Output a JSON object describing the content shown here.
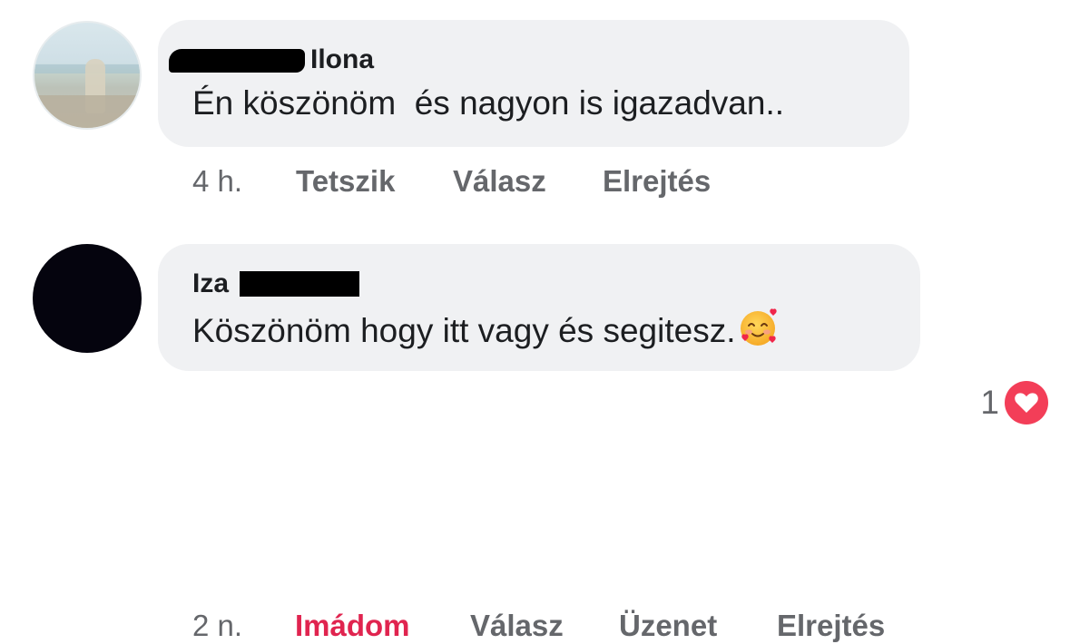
{
  "comments": [
    {
      "author_visible": "Ilona",
      "text": "Én köszönöm  és nagyon is igazadvan..",
      "actions": {
        "time": "4 h.",
        "like": "Tetszik",
        "reply": "Válasz",
        "hide": "Elrejtés"
      }
    },
    {
      "author_visible": "Iza",
      "text": "Köszönöm hogy itt vagy és segitesz.",
      "emoji": "smiling-face-with-hearts",
      "actions": {
        "time": "2 n.",
        "reaction": "Imádom",
        "reply": "Válasz",
        "message": "Üzenet",
        "hide": "Elrejtés"
      },
      "reaction_count": "1",
      "reaction_type": "love"
    }
  ],
  "colors": {
    "bubble": "#f0f1f3",
    "text": "#1c1e21",
    "secondary": "#65676b",
    "love": "#e0244f",
    "love_badge": "#f33e58"
  }
}
